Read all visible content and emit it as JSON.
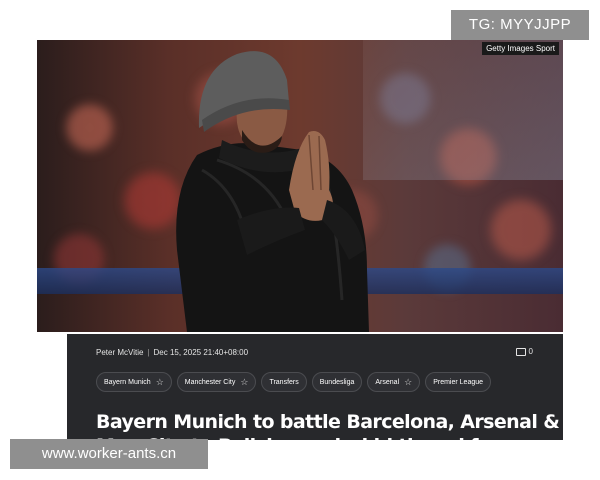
{
  "watermarks": {
    "telegram": "TG: MYYJJPP",
    "website": "www.worker-ants.cn"
  },
  "photo": {
    "credit": "Getty Images Sport"
  },
  "article": {
    "author": "Peter McVitie",
    "separator": "|",
    "timestamp": "Dec 15, 2025 21:40+08:00",
    "comment_count": "0",
    "tags": [
      {
        "label": "Bayern Munich",
        "icon": "star-icon"
      },
      {
        "label": "Manchester City",
        "icon": "star-icon"
      },
      {
        "label": "Transfers",
        "icon": null
      },
      {
        "label": "Bundesliga",
        "icon": null
      },
      {
        "label": "Arsenal",
        "icon": "star-icon"
      },
      {
        "label": "Premier League",
        "icon": null
      }
    ],
    "headline": "Bayern Munich to battle Barcelona, Arsenal & Man City to Polish wonderkid tipped for"
  },
  "colors": {
    "card_background": "#27282b",
    "watermark_background": "#8f8f8f"
  }
}
